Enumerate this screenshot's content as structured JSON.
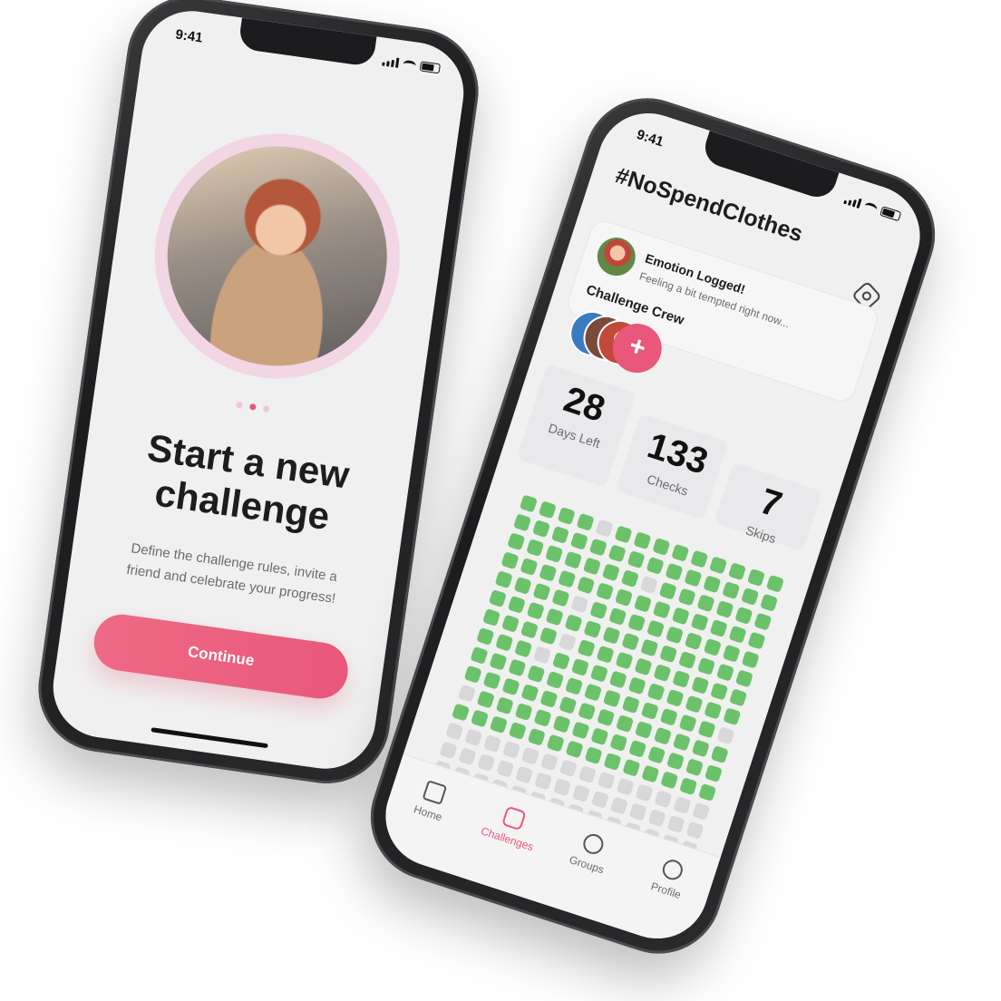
{
  "left_screen": {
    "status_time": "9:41",
    "title": "Start a new challenge",
    "subtitle": "Define the challenge rules, invite a friend and celebrate your progress!",
    "continue_label": "Continue",
    "page_dots": 3,
    "active_dot": 2
  },
  "right_screen": {
    "status_time": "9:41",
    "hashtag": "#NoSpendClothes",
    "emotion": {
      "title": "Emotion Logged!",
      "subtitle": "Feeling a bit tempted right now..."
    },
    "crew_title": "Challenge Crew",
    "stats": [
      {
        "value": "28",
        "label": "Days Left"
      },
      {
        "value": "133",
        "label": "Checks"
      },
      {
        "value": "7",
        "label": "Skips"
      }
    ],
    "tabs": [
      {
        "label": "Home",
        "icon": "home-icon",
        "active": false
      },
      {
        "label": "Challenges",
        "icon": "calendar-icon",
        "active": true
      },
      {
        "label": "Groups",
        "icon": "chat-icon",
        "active": false
      },
      {
        "label": "Profile",
        "icon": "user-icon",
        "active": false
      }
    ]
  },
  "colors": {
    "accent": "#e9577a",
    "check_done": "#6cc26a",
    "check_empty": "#d8d8da"
  }
}
